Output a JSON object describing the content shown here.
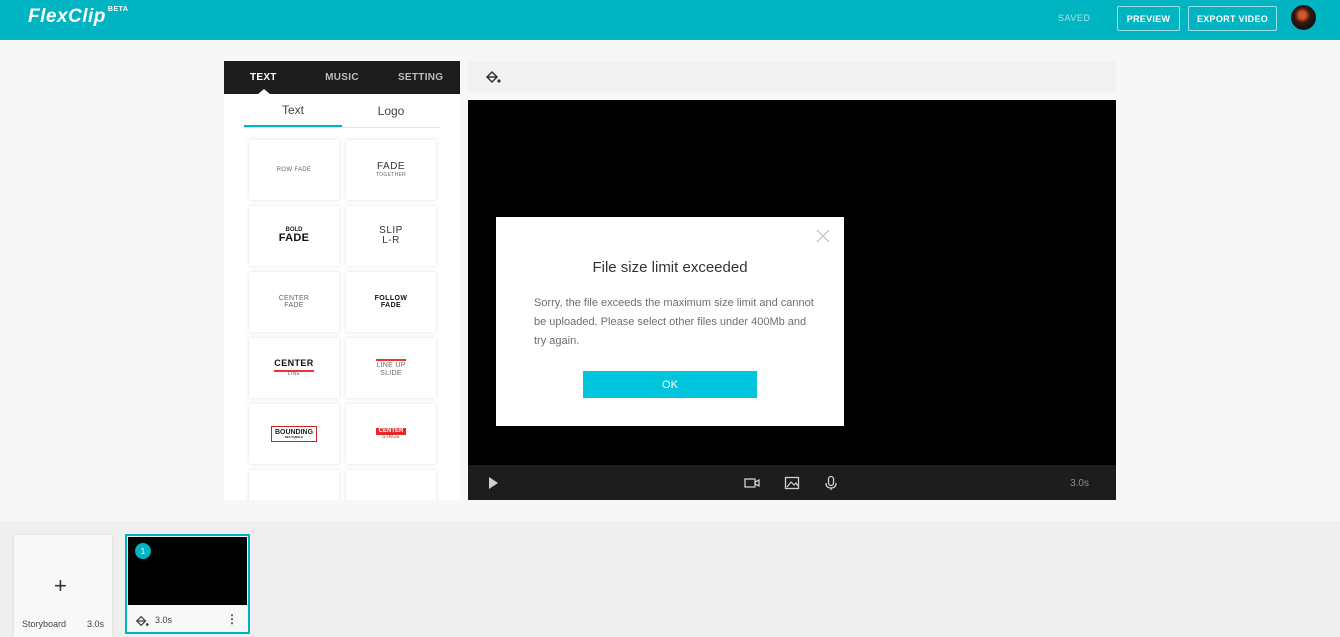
{
  "header": {
    "logo": "FlexClip",
    "logo_badge": "BETA",
    "saved_status": "SAVED",
    "preview_label": "PREVIEW",
    "export_label": "EXPORT VIDEO"
  },
  "panel": {
    "tabs": [
      {
        "label": "TEXT",
        "active": true
      },
      {
        "label": "MUSIC",
        "active": false
      },
      {
        "label": "SETTING",
        "active": false
      }
    ],
    "subtabs": [
      {
        "label": "Text",
        "active": true
      },
      {
        "label": "Logo",
        "active": false
      }
    ],
    "styles": [
      {
        "line1": "ROW FADE",
        "line2": ""
      },
      {
        "line1": "FADE",
        "line2": "TOGETHER"
      },
      {
        "line1": "BOLD",
        "line2": "FADE"
      },
      {
        "line1": "SLIP",
        "line2": "L-R"
      },
      {
        "line1": "CENTER",
        "line2": "FADE"
      },
      {
        "line1": "FOLLOW",
        "line2": "FADE"
      },
      {
        "line1": "CENTER",
        "line2": "LINE"
      },
      {
        "line1": "LINE UP",
        "line2": "SLIDE"
      },
      {
        "line1": "BOUNDING",
        "line2": "RECTANGLE"
      },
      {
        "line1": "CENTER",
        "line2": "STAGE"
      }
    ]
  },
  "player": {
    "duration": "3.0s"
  },
  "modal": {
    "title": "File size limit exceeded",
    "message": "Sorry, the file exceeds the maximum size limit and cannot be uploaded. Please select other files under 400Mb and try again.",
    "ok_label": "OK"
  },
  "storyboard": {
    "label": "Storyboard",
    "total_duration": "3.0s",
    "add_symbol": "+",
    "clips": [
      {
        "number": "1",
        "duration": "3.0s"
      }
    ]
  },
  "colors": {
    "brand": "#00b4c2",
    "ok_button": "#00c5dc"
  }
}
